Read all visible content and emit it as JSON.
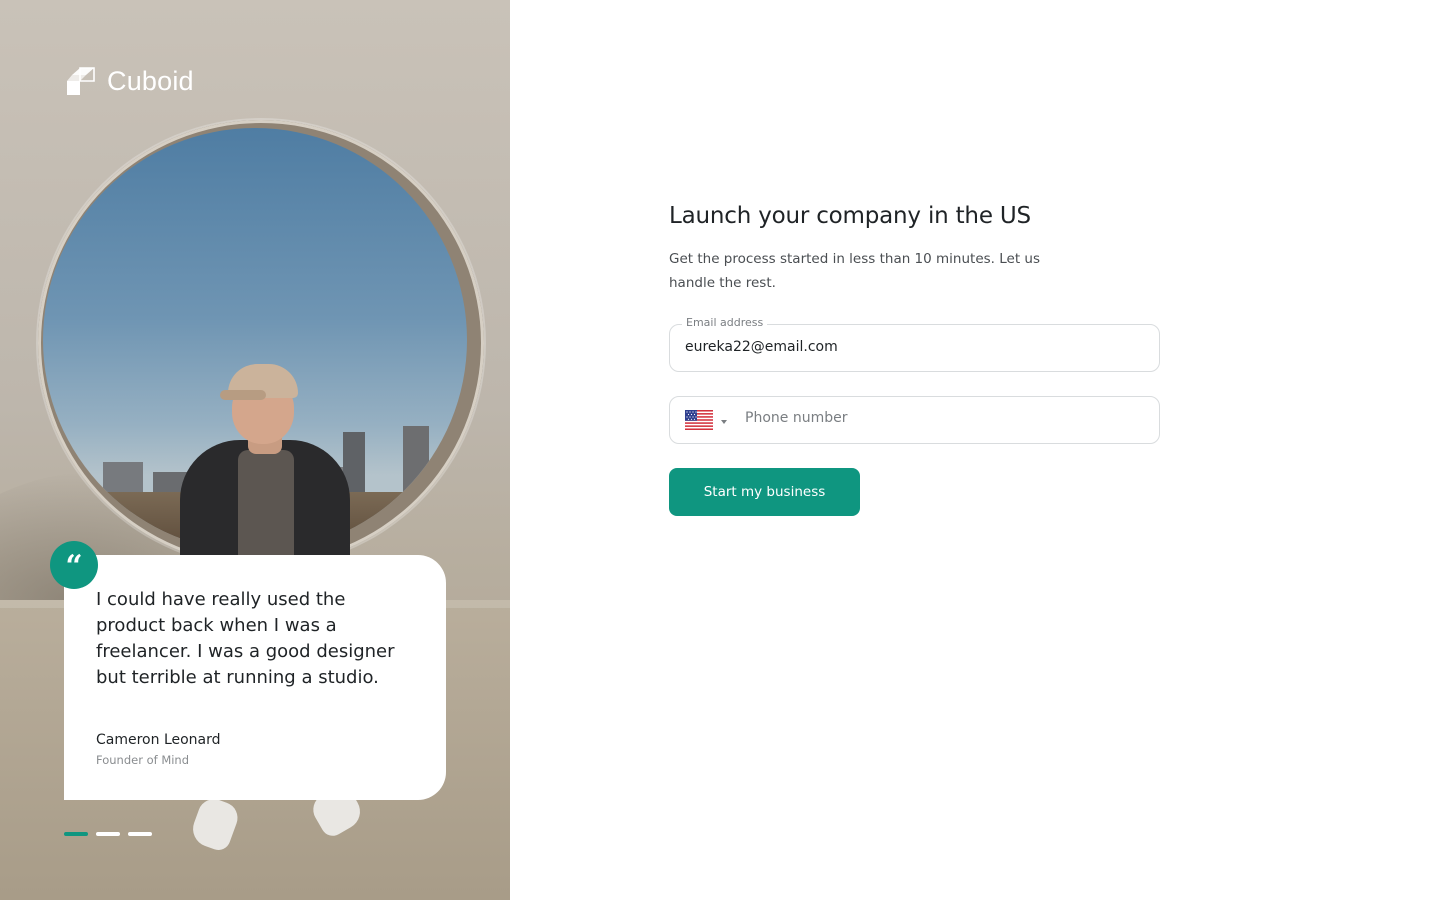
{
  "brand": {
    "name": "Cuboid",
    "logo_icon": "cube-logo-icon"
  },
  "testimonial": {
    "quote_mark": "“",
    "quote": "I could have really used the product back when I was a freelancer. I was a good designer but terrible at running a studio.",
    "author": "Cameron Leonard",
    "role": "Founder of Mind",
    "carousel_total": 3,
    "carousel_active": 1
  },
  "form": {
    "title": "Launch your company in the US",
    "subtitle": "Get the process started in less than 10 minutes. Let us handle the rest.",
    "email": {
      "label": "Email address",
      "value": "eureka22@email.com"
    },
    "phone": {
      "country_icon": "us-flag-icon",
      "placeholder": "Phone number"
    },
    "submit_label": "Start my business"
  },
  "colors": {
    "accent": "#0f9680",
    "text": "#1f2326",
    "muted": "#7a7e82",
    "border": "#d9dcde"
  }
}
